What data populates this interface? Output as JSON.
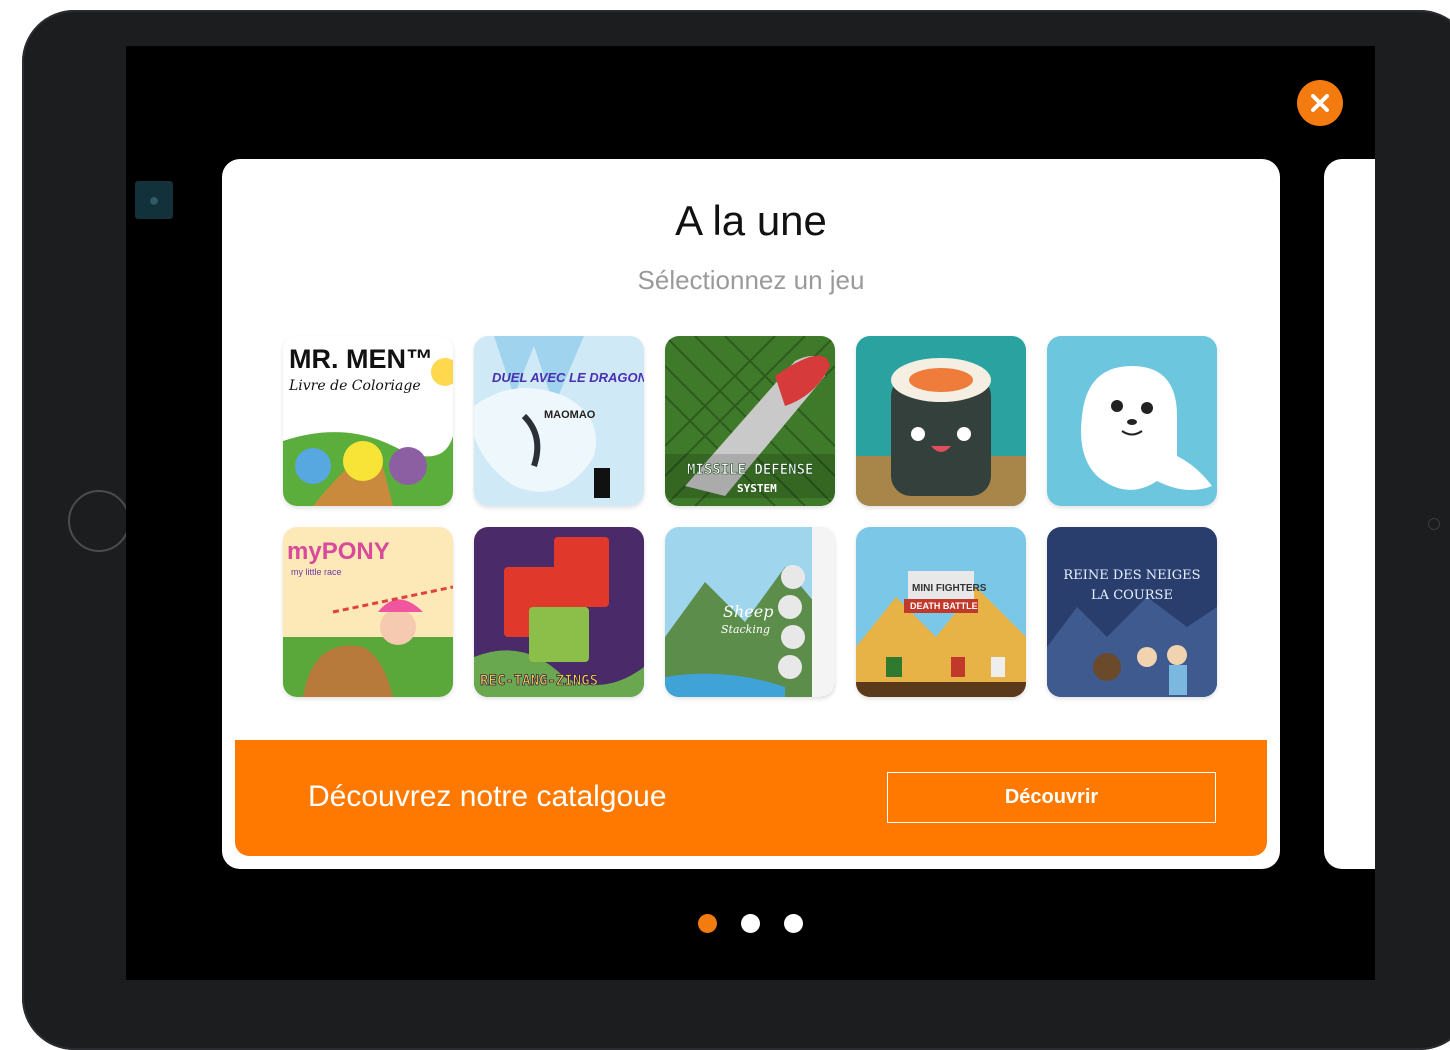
{
  "header": {
    "title": "A la une",
    "subtitle": "Sélectionnez un jeu"
  },
  "games": [
    {
      "name": "MR. MEN Livre de Coloriage",
      "line1": "MR. MEN™",
      "line2": "Livre de Coloriage"
    },
    {
      "name": "Duel avec le Dragon",
      "line1": "DUEL AVEC LE DRAGON",
      "line2": "MAOMAO"
    },
    {
      "name": "Missile Defense System",
      "line1": "MISSILE DEFENSE",
      "line2": "SYSTEM"
    },
    {
      "name": "Sushi",
      "line1": "",
      "line2": ""
    },
    {
      "name": "Seal",
      "line1": "",
      "line2": ""
    },
    {
      "name": "My Pony my little race",
      "line1": "myPONY",
      "line2": "my little race"
    },
    {
      "name": "Rec-Tang-Zings",
      "line1": "REC-TANG-ZINGS",
      "line2": ""
    },
    {
      "name": "Sheep Stacking",
      "line1": "Sheep",
      "line2": "Stacking"
    },
    {
      "name": "Mini Fighters Death Battle",
      "line1": "MINI FIGHTERS",
      "line2": "DEATH BATTLE"
    },
    {
      "name": "La Reine des Neiges La Course",
      "line1": "REINE DES NEIGES",
      "line2": "LA COURSE"
    }
  ],
  "promo": {
    "text": "Découvrez notre catalgoue",
    "button": "Découvrir"
  },
  "pagination": {
    "total": 3,
    "active": 1
  },
  "colors": {
    "accent": "#ff7900",
    "close": "#f47b10"
  }
}
